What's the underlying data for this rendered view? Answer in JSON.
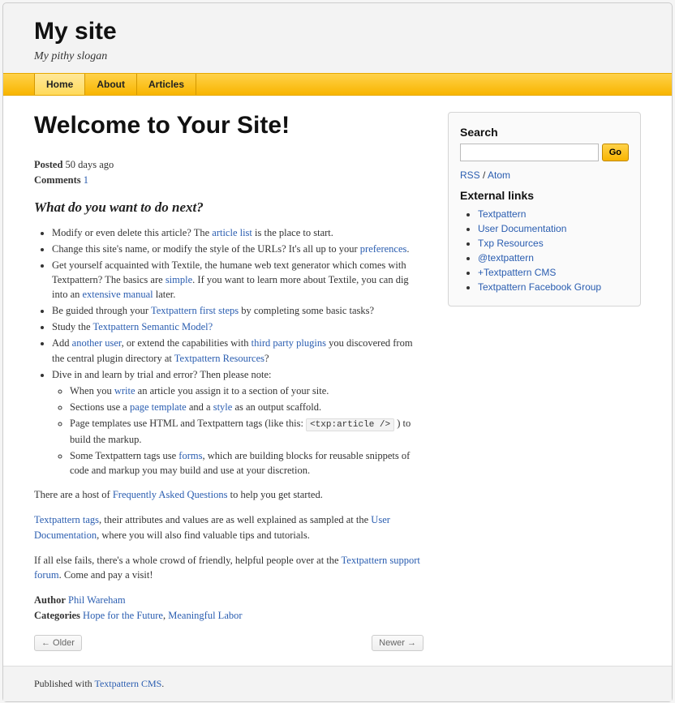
{
  "header": {
    "title": "My site",
    "slogan": "My pithy slogan"
  },
  "nav": {
    "items": [
      {
        "label": "Home",
        "active": true
      },
      {
        "label": "About",
        "active": false
      },
      {
        "label": "Articles",
        "active": false
      }
    ]
  },
  "article": {
    "title": "Welcome to Your Site!",
    "posted_label": "Posted",
    "posted_value": "50 days ago",
    "comments_label": "Comments",
    "comments_count": "1",
    "subheading": "What do you want to do next?",
    "bullets": {
      "b1_a": "Modify or even delete this article? The ",
      "b1_link": "article list",
      "b1_b": " is the place to start.",
      "b2_a": "Change this site's name, or modify the style of the URLs? It's all up to your ",
      "b2_link": "preferences",
      "b2_b": ".",
      "b3_a": "Get yourself acquainted with Textile, the humane web text generator which comes with Textpattern? The basics are ",
      "b3_link1": "simple",
      "b3_b": ". If you want to learn more about Textile, you can dig into an ",
      "b3_link2": "extensive manual",
      "b3_c": " later.",
      "b4_a": "Be guided through your ",
      "b4_link": "Textpattern first steps",
      "b4_b": " by completing some basic tasks?",
      "b5_a": "Study the ",
      "b5_link": "Textpattern Semantic Model?",
      "b6_a": "Add ",
      "b6_link1": "another user",
      "b6_b": ", or extend the capabilities with ",
      "b6_link2": "third party plugins",
      "b6_c": " you discovered from the central plugin directory at ",
      "b6_link3": "Textpattern Resources",
      "b6_d": "?",
      "b7_a": "Dive in and learn by trial and error? Then please note:",
      "s1_a": "When you ",
      "s1_link": "write",
      "s1_b": " an article you assign it to a section of your site.",
      "s2_a": "Sections use a ",
      "s2_link1": "page template",
      "s2_b": " and a ",
      "s2_link2": "style",
      "s2_c": " as an output scaffold.",
      "s3_a": "Page templates use HTML and Textpattern tags (like this: ",
      "s3_code": "<txp:article />",
      "s3_b": " ) to build the markup.",
      "s4_a": "Some Textpattern tags use ",
      "s4_link": "forms",
      "s4_b": ", which are building blocks for reusable snippets of code and markup you may build and use at your discretion."
    },
    "p1_a": "There are a host of ",
    "p1_link": "Frequently Asked Questions",
    "p1_b": " to help you get started.",
    "p2_link1": "Textpattern tags",
    "p2_a": ", their attributes and values are as well explained as sampled at the ",
    "p2_link2": "User Documentation",
    "p2_b": ", where you will also find valuable tips and tutorials.",
    "p3_a": "If all else fails, there's a whole crowd of friendly, helpful people over at the ",
    "p3_link": "Textpattern support forum",
    "p3_b": ". Come and pay a visit!",
    "author_label": "Author",
    "author": "Phil Wareham",
    "categories_label": "Categories",
    "cat1": "Hope for the Future",
    "cat_sep": ", ",
    "cat2": "Meaningful Labor"
  },
  "pagination": {
    "older": "← Older",
    "newer": "Newer →"
  },
  "sidebar": {
    "search_heading": "Search",
    "go_label": "Go",
    "rss": "RSS",
    "feed_sep": " / ",
    "atom": "Atom",
    "ext_heading": "External links",
    "links": [
      "Textpattern",
      "User Documentation",
      "Txp Resources",
      "@textpattern",
      "+Textpattern CMS",
      "Textpattern Facebook Group"
    ]
  },
  "footer": {
    "text_a": "Published with ",
    "link": "Textpattern CMS",
    "text_b": "."
  }
}
